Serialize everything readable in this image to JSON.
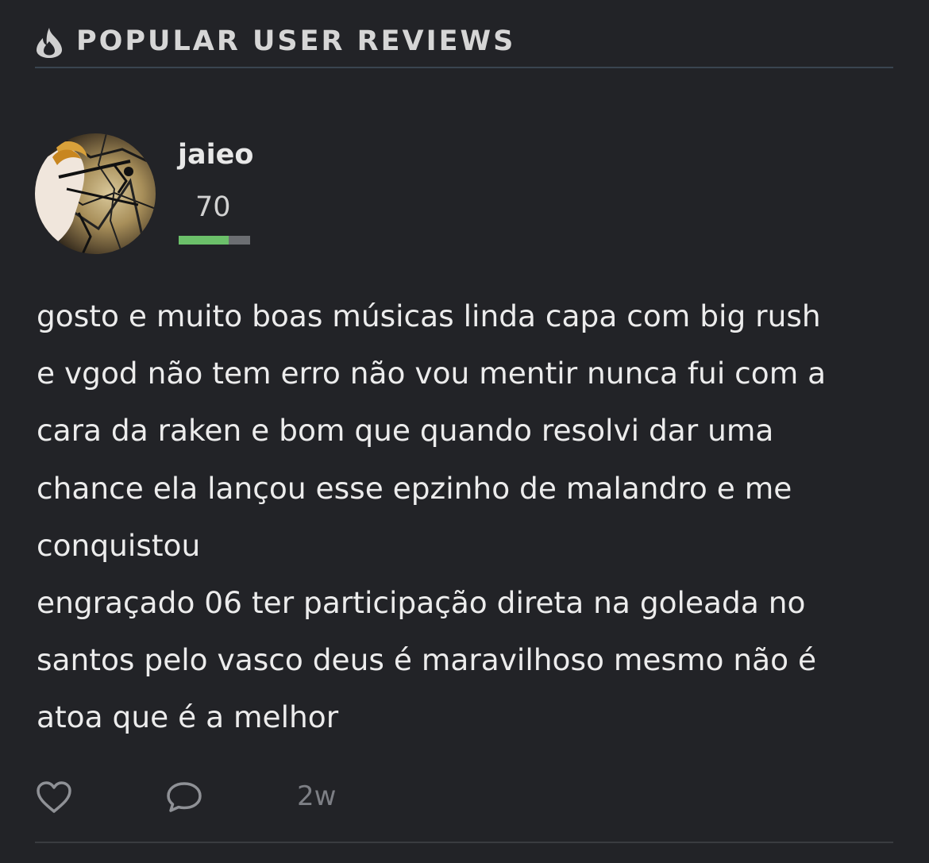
{
  "section": {
    "title": "POPULAR USER REVIEWS",
    "icon": "flame-icon"
  },
  "review": {
    "username": "jaieo",
    "score": "70",
    "score_fraction": 0.7,
    "text": "gosto e muito boas músicas linda capa com big rush\ne vgod não tem erro não vou mentir nunca fui com a\ncara da raken e bom que quando resolvi dar uma\nchance ela lançou esse epzinho de malandro e me\nconquistou\nengraçado 06 ter participação direta na goleada no\nsantos pelo vasco deus é maravilhoso mesmo não é\natoa que é a melhor",
    "time": "2w"
  },
  "actions": {
    "like_icon": "heart-icon",
    "comment_icon": "comment-icon"
  },
  "colors": {
    "background": "#222327",
    "score_bar_fill": "#6cc06a",
    "score_bar_track": "#6c6e72"
  }
}
